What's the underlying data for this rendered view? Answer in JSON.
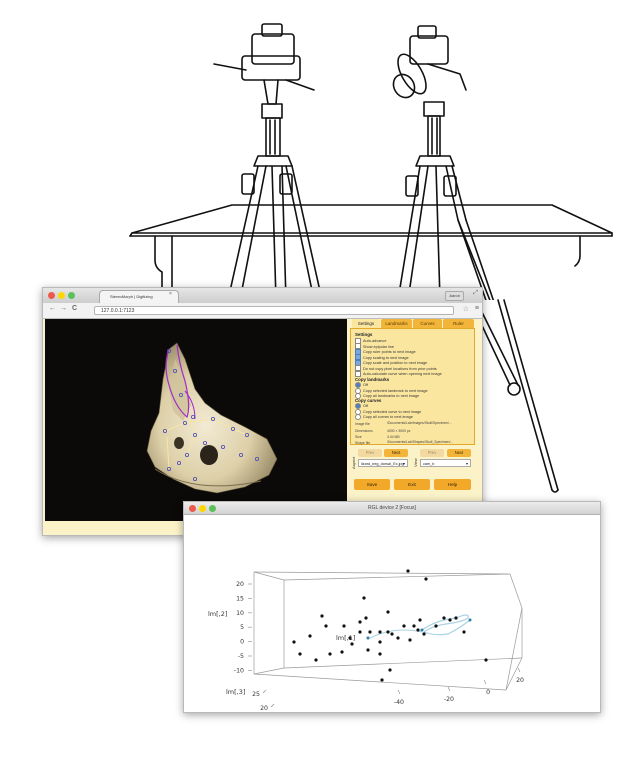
{
  "browser": {
    "tab_title": "StereoMorph | Digitizing",
    "tab_close": "×",
    "user_badge": "Aaron",
    "url": "127.0.0.1:7123",
    "nav": {
      "back": "←",
      "forward": "→",
      "reload": "C"
    },
    "window_controls_colors": [
      "#ed594a",
      "#fdd800",
      "#5ac05a"
    ],
    "panel": {
      "tabs": [
        "Settings",
        "Landmarks",
        "Curves",
        "Ruler"
      ],
      "active_tab": "Settings",
      "settings": {
        "header": "Settings",
        "options": [
          {
            "label": "Auto-advance",
            "checked": false
          },
          {
            "label": "Show epipolar line",
            "checked": false
          },
          {
            "label": "Copy ruler points to next image",
            "checked": true
          },
          {
            "label": "Copy scaling to next image",
            "checked": true
          },
          {
            "label": "Copy scale and position to next image",
            "checked": true
          },
          {
            "label": "Do not copy pixel locations from prior points",
            "checked": false
          },
          {
            "label": "Auto-calculate curve when opening next image",
            "checked": false
          }
        ]
      },
      "copy_landmarks": {
        "header": "Copy landmarks",
        "options": [
          {
            "label": "Off",
            "selected": true
          },
          {
            "label": "Copy selected landmark to next image",
            "selected": false
          },
          {
            "label": "Copy all landmarks to next image",
            "selected": false
          }
        ]
      },
      "copy_curves": {
        "header": "Copy curves",
        "options": [
          {
            "label": "Off",
            "selected": true
          },
          {
            "label": "Copy selected curve to next image",
            "selected": false
          },
          {
            "label": "Copy all curves to next image",
            "selected": false
          }
        ]
      },
      "info": [
        {
          "key": "Image file",
          "value": "/Documents/Lab/Images/Skull/Specimen/..."
        },
        {
          "key": "Dimensions",
          "value": "4000 × 3000 px"
        },
        {
          "key": "Size",
          "value": "4.04 MB"
        },
        {
          "key": "Shape file",
          "value": "/Documents/Lab/Shapes/Skull_Specimen/..."
        }
      ],
      "aspect_label": "Aspect",
      "view_label": "View",
      "prev_label": "Prev",
      "next_label": "Next",
      "aspect_select": "lizard_neg_dorsal_Ex.jpg",
      "view_select": "cam_b",
      "buttons": {
        "save": "Save",
        "exit": "Exit",
        "help": "Help"
      },
      "accent_color": "#f2a92a"
    },
    "status": "Current mouse position: 2360, 74"
  },
  "rgl": {
    "title": "RGL device 2 [Focus]",
    "controls_colors": [
      "#ed594a",
      "#fdd800",
      "#5ac05a"
    ]
  },
  "chart_data": {
    "type": "scatter",
    "title": "",
    "axes": {
      "y": {
        "label": "lm[,2]",
        "ticks": [
          -10,
          -5,
          0,
          5,
          10,
          15,
          20
        ]
      },
      "x": {
        "label": "lm[,1]",
        "ticks": [
          -40,
          -20,
          0,
          20
        ]
      },
      "z": {
        "label": "lm[,3]",
        "ticks": [
          25,
          20
        ]
      }
    },
    "points_color": "#111111",
    "curve_color": "#a9d2e4",
    "curve_dot_color": "#2a7fae"
  }
}
